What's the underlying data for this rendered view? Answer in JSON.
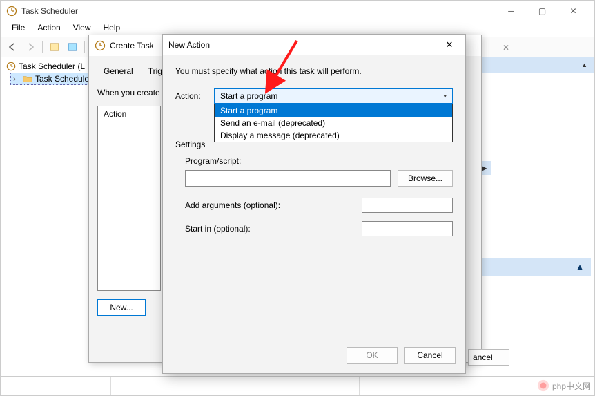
{
  "main_window": {
    "title": "Task Scheduler",
    "menu": [
      "File",
      "Action",
      "View",
      "Help"
    ],
    "tree": {
      "root": "Task Scheduler (L",
      "child": "Task Schedule"
    }
  },
  "create_task_dialog": {
    "title": "Create Task",
    "tabs": [
      "General",
      "Triggers"
    ],
    "hint": "When you create",
    "list_header": "Action",
    "new_button": "New..."
  },
  "new_action_dialog": {
    "title": "New Action",
    "instruction": "You must specify what action this task will perform.",
    "action_label": "Action:",
    "action_selected": "Start a program",
    "action_options": [
      "Start a program",
      "Send an e-mail (deprecated)",
      "Display a message (deprecated)"
    ],
    "settings_label": "Settings",
    "program_label": "Program/script:",
    "browse_label": "Browse...",
    "arguments_label": "Add arguments (optional):",
    "startin_label": "Start in (optional):",
    "ok_label": "OK",
    "cancel_label": "Cancel"
  },
  "peek": {
    "cancel": "ancel"
  },
  "watermark": "php中文网"
}
